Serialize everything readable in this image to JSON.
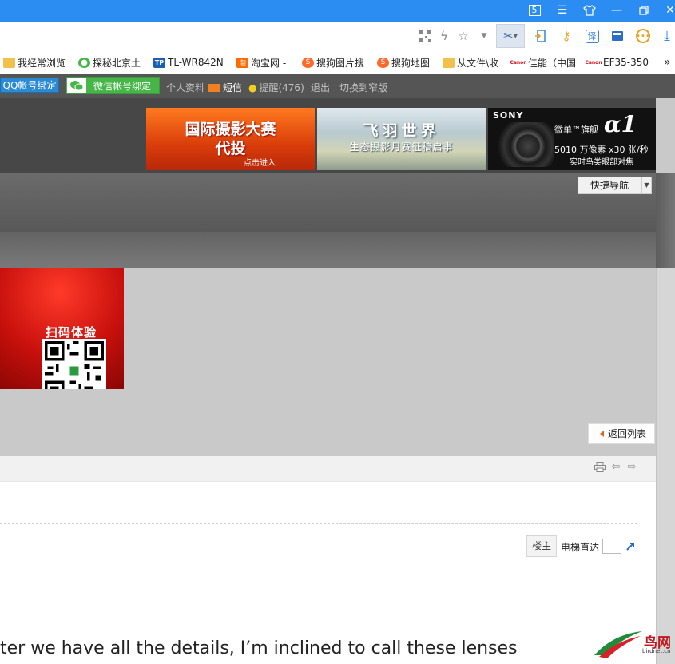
{
  "titlebar": {
    "tab_count": "5",
    "icons": [
      "tab-count-icon",
      "menu-icon",
      "skin-icon",
      "minimize-icon",
      "restore-icon",
      "close-icon"
    ]
  },
  "toolbar": {
    "icons": [
      "qr-code-icon",
      "lightning-icon",
      "star-icon",
      "dropdown-icon",
      "scissors-icon",
      "sync-icon",
      "key-icon",
      "translate-icon",
      "screen-icon",
      "emoji-icon",
      "download-icon"
    ]
  },
  "bookmarks": [
    {
      "label": "我经常浏览",
      "icon": "folder-icon"
    },
    {
      "label": "探秘北京土",
      "icon": "wechat-icon"
    },
    {
      "label": "TL-WR842N",
      "icon": "tp-link-icon"
    },
    {
      "label": "淘宝网 -",
      "icon": "taobao-icon"
    },
    {
      "label": "搜狗图片搜",
      "icon": "sogou-icon"
    },
    {
      "label": "搜狗地图",
      "icon": "sogou-icon"
    },
    {
      "label": "从文件\\收",
      "icon": "folder-icon"
    },
    {
      "label": "佳能（中国",
      "icon": "canon-icon"
    },
    {
      "label": "EF35-350",
      "icon": "canon-icon"
    }
  ],
  "bookmarks_more": "»",
  "sitebar": {
    "qq_bind": "QQ帐号绑定",
    "wechat_bind": "微信帐号绑定",
    "profile": "个人资料",
    "messages": "短信",
    "reminders": "提醒(476)",
    "logout": "退出",
    "switch_width": "切换到窄版"
  },
  "ads": {
    "ad1_title": "国际摄影大赛",
    "ad1_sub": "代投",
    "ad1_cta": "点击进入",
    "ad2_title": "飞羽世界",
    "ad2_sub": "生态摄影月赛征稿启事",
    "ad3_brand": "SONY",
    "ad3_title": "微单™旗舰",
    "ad3_model": "α1",
    "ad3_line1": "5010 万像素 x30 张/秒",
    "ad3_line2": "实时鸟类眼部对焦"
  },
  "quick_nav": "快捷导航",
  "qr_banner": {
    "title": "扫码体验"
  },
  "back_to_list": "返回列表",
  "post": {
    "floor_owner": "楼主",
    "elevator_label": "电梯直达",
    "body_text": "ter we have all the details, I’m inclined to call these lenses"
  },
  "logo": {
    "name": "鸟网",
    "domain": "birdnet.cn"
  },
  "colors": {
    "titlebar": "#2b8cf2",
    "wechat_green": "#46b649",
    "qq_blue": "#2a8ad4",
    "header_dark": "#474747"
  }
}
